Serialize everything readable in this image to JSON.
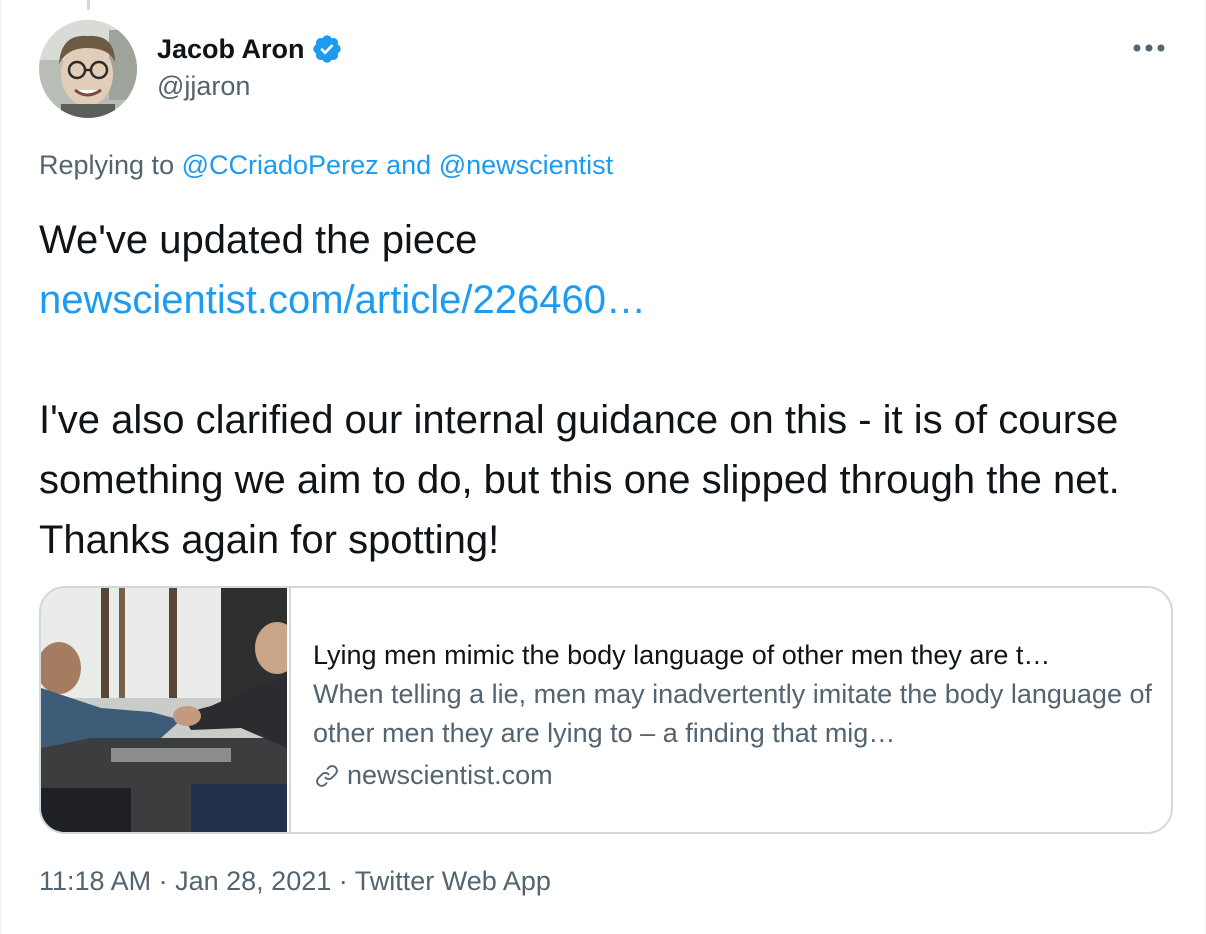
{
  "author": {
    "display_name": "Jacob Aron",
    "handle": "@jjaron",
    "verified": true,
    "avatar_icon": "avatar-photo"
  },
  "menu_icon": "more-options-icon",
  "reply": {
    "prefix": "Replying to",
    "user1": "@CCriadoPerez",
    "joiner": "and",
    "user2": "@newscientist"
  },
  "tweet": {
    "line1": "We've updated the piece",
    "link": "newscientist.com/article/226460…",
    "paragraph2": "I've also clarified our internal guidance on this - it is of course something we aim to do, but this one slipped through the net. Thanks again for spotting!"
  },
  "card": {
    "title": "Lying men mimic the body language of other men they are t…",
    "description": "When telling a lie, men may inadvertently imitate the body language of other men they are lying to – a finding that mig…",
    "domain": "newscientist.com",
    "image_icon": "handshake-photo"
  },
  "meta": {
    "time": "11:18 AM",
    "separator": "·",
    "date": "Jan 28, 2021",
    "source": "Twitter Web App"
  },
  "colors": {
    "link": "#1d9bf0",
    "secondary_text": "#536471",
    "primary_text": "#0f1419",
    "border": "#cfd9de"
  }
}
